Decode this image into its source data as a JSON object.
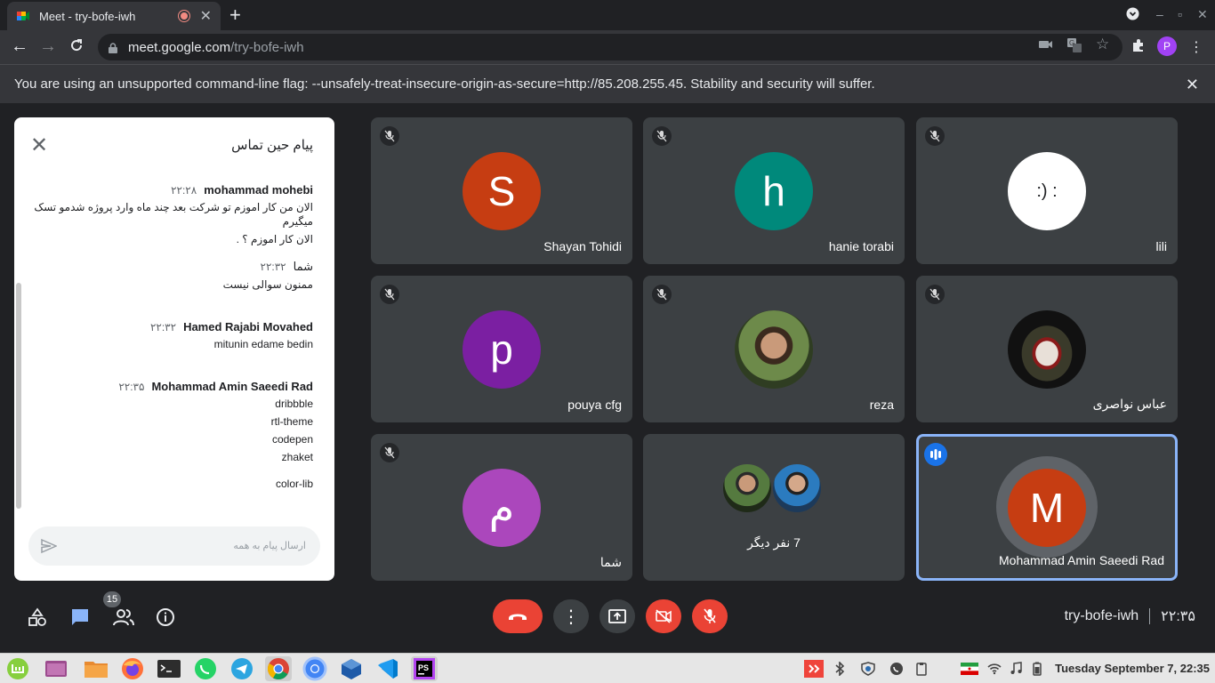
{
  "browser": {
    "tab_title": "Meet - try-bofe-iwh",
    "url_host": "meet.google.com",
    "url_path": "/try-bofe-iwh",
    "profile_initial": "P",
    "infobar_message": "You are using an unsupported command-line flag: --unsafely-treat-insecure-origin-as-secure=http://85.208.255.45. Stability and security will suffer."
  },
  "chat": {
    "heading": "پیام حین تماس",
    "messages": [
      {
        "sender": "mohammad mohebi",
        "time": "۲۲:۲۸",
        "lines": [
          "الان من کار اموزم تو شرکت بعد چند ماه وارد پروژه شدمو تسک میگیرم",
          "الان کار اموزم ؟ ."
        ]
      },
      {
        "sender": "شما",
        "time": "۲۲:۳۲",
        "lines": [
          "ممنون سوالی نیست"
        ]
      },
      {
        "sender": "Hamed Rajabi Movahed",
        "time": "۲۲:۳۲",
        "lines": [
          "mitunin edame bedin"
        ]
      },
      {
        "sender": "Mohammad Amin Saeedi Rad",
        "time": "۲۲:۳۵",
        "lines": [
          "dribbble",
          "rtl-theme",
          "codepen",
          "zhaket",
          "color-lib"
        ]
      }
    ],
    "input_placeholder": "ارسال پیام به همه"
  },
  "participants": [
    {
      "name": "Shayan Tohidi",
      "initial": "S",
      "color": "#c63d12",
      "muted": true
    },
    {
      "name": "hanie torabi",
      "initial": "h",
      "color": "#00897b",
      "muted": true
    },
    {
      "name": "lili",
      "initial": ":) :",
      "color": "#ffffff",
      "muted": true
    },
    {
      "name": "pouya cfg",
      "initial": "p",
      "color": "#7b1fa2",
      "muted": true
    },
    {
      "name": "reza",
      "initial": "",
      "color": "#4e6a3a",
      "muted": true,
      "photo": true
    },
    {
      "name": "عباس نواصری",
      "initial": "",
      "color": "#1a1a1a",
      "muted": true,
      "photo": true
    },
    {
      "name": "شما",
      "initial": "م",
      "color": "#ab47bc",
      "muted": true
    },
    {
      "name": "7 نفر دیگر",
      "initial": "",
      "color": "",
      "muted": false,
      "group": true
    },
    {
      "name": "Mohammad Amin Saeedi Rad",
      "initial": "M",
      "color": "#c63d12",
      "muted": false,
      "speaking": true
    }
  ],
  "controls": {
    "people_count": "15",
    "meeting_code": "try-bofe-iwh",
    "time": "۲۲:۳۵"
  },
  "taskbar": {
    "clock": "Tuesday September  7, 22:35"
  }
}
